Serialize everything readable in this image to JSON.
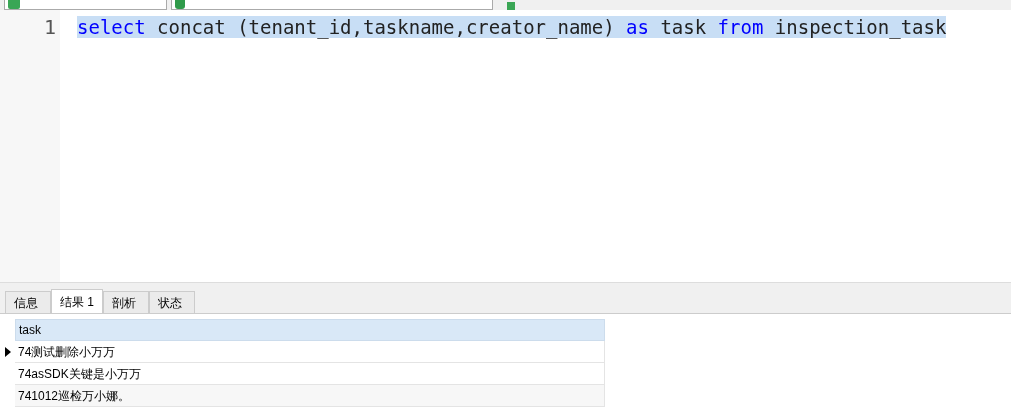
{
  "editor": {
    "lines": [
      {
        "number": "1",
        "selected": true,
        "tokens": [
          {
            "text": "select",
            "kind": "keyword"
          },
          {
            "text": " concat (tenant_id,taskname,creator_name) ",
            "kind": "plain"
          },
          {
            "text": "as",
            "kind": "keyword"
          },
          {
            "text": " task ",
            "kind": "plain"
          },
          {
            "text": "from",
            "kind": "keyword"
          },
          {
            "text": " inspection_task",
            "kind": "plain"
          }
        ]
      }
    ]
  },
  "tabs": [
    {
      "label": "信息",
      "selected": false
    },
    {
      "label": "结果 1",
      "selected": true
    },
    {
      "label": "剖析",
      "selected": false
    },
    {
      "label": "状态",
      "selected": false
    }
  ],
  "table": {
    "columns": [
      "task"
    ],
    "rows": [
      {
        "cells": [
          "74测试删除小万万"
        ],
        "selected": true
      },
      {
        "cells": [
          "74asSDK关键是小万万"
        ],
        "selected": false
      },
      {
        "cells": [
          "741012巡检万小娜。"
        ],
        "selected": false
      }
    ]
  }
}
